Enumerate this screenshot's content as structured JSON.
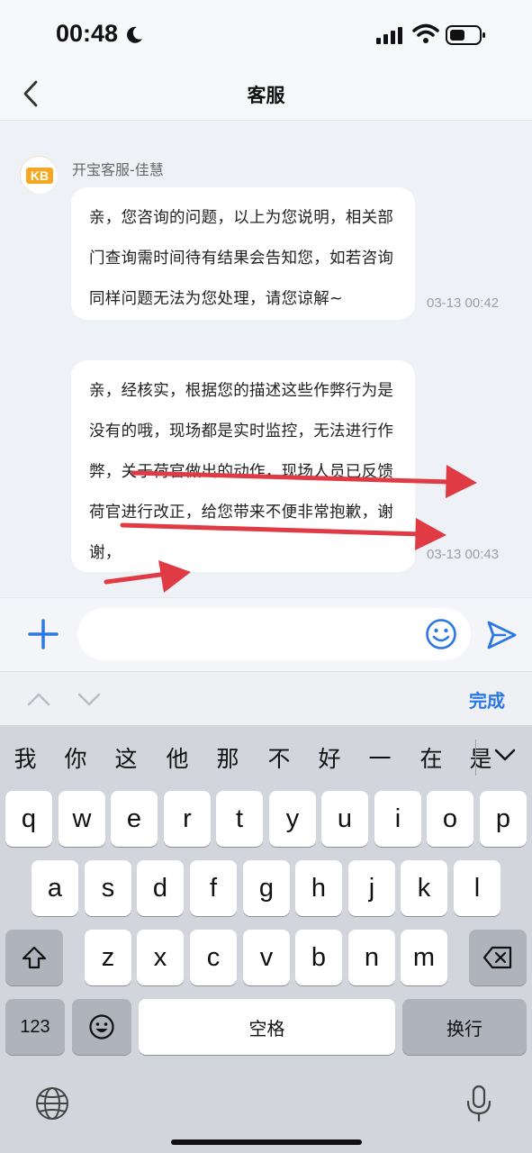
{
  "status_bar": {
    "time": "00:48"
  },
  "nav": {
    "title": "客服"
  },
  "chat": {
    "agent_name": "开宝客服-佳慧",
    "avatar_text": "KB",
    "messages": [
      {
        "lines": [
          "亲，您咨询的问题，以上为您说明，相关部",
          "门查询需时间待有结果会告知您，如若咨询",
          "同样问题无法为您处理，请您谅解~"
        ],
        "time": "03-13 00:42"
      },
      {
        "lines": [
          "亲，经核实，根据您的描述这些作弊行为是",
          "没有的哦，现场都是实时监控，无法进行作",
          "弊，关于荷官做出的动作，现场人员已反馈",
          "荷官进行改正，给您带来不便非常抱歉，谢",
          "谢，"
        ],
        "time": "03-13 00:43"
      }
    ],
    "annotation_color": "#e03a44"
  },
  "input": {
    "value": "",
    "placeholder": ""
  },
  "keyboard_toolbar": {
    "done_label": "完成",
    "accent_color": "#2b78e4"
  },
  "keyboard": {
    "candidates": [
      "我",
      "你",
      "这",
      "他",
      "那",
      "不",
      "好",
      "一",
      "在",
      "是"
    ],
    "row1": [
      "q",
      "w",
      "e",
      "r",
      "t",
      "y",
      "u",
      "i",
      "o",
      "p"
    ],
    "row2": [
      "a",
      "s",
      "d",
      "f",
      "g",
      "h",
      "j",
      "k",
      "l"
    ],
    "row3": [
      "z",
      "x",
      "c",
      "v",
      "b",
      "n",
      "m"
    ],
    "numbers_label": "123",
    "space_label": "空格",
    "return_label": "换行"
  }
}
